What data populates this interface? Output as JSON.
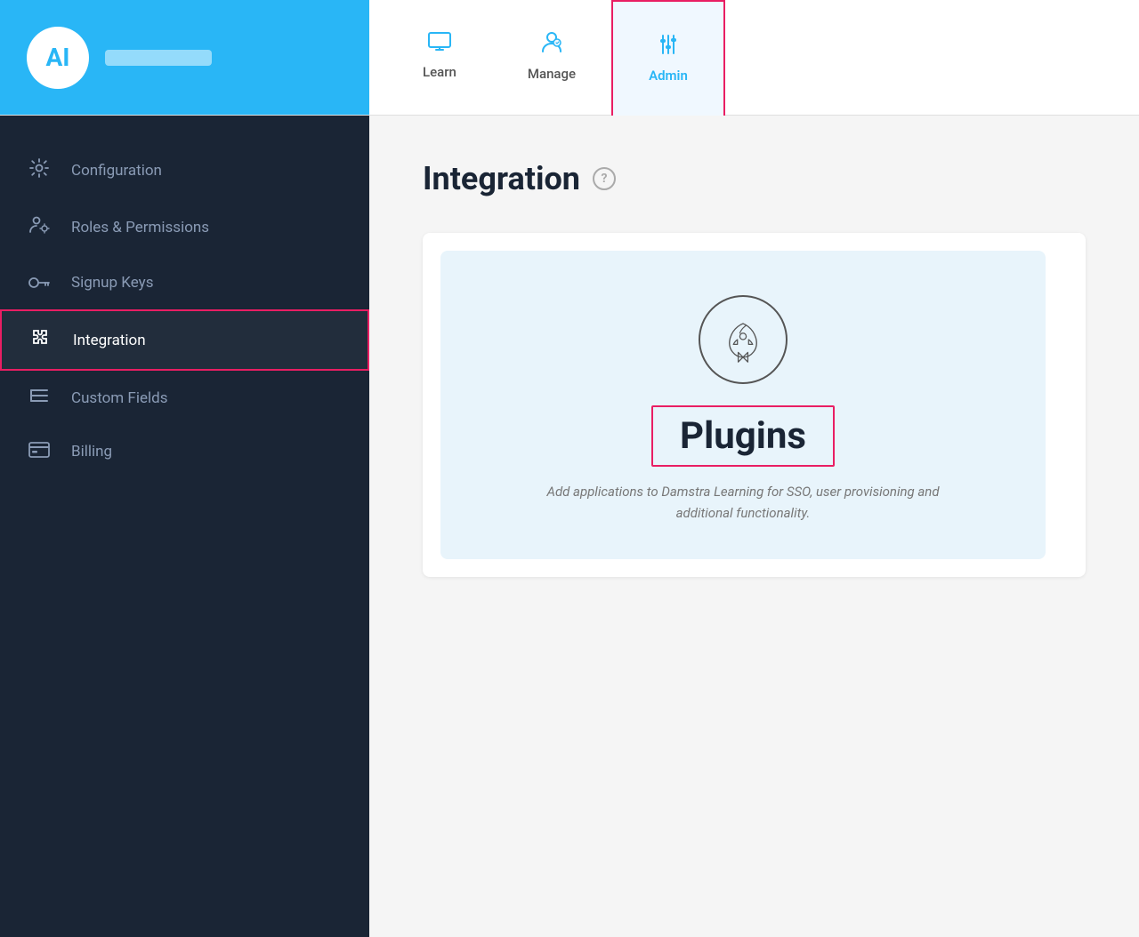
{
  "brand": {
    "initials": "AI",
    "name_blurred": true
  },
  "header": {
    "tabs": [
      {
        "id": "learn",
        "label": "Learn",
        "icon": "monitor",
        "active": false
      },
      {
        "id": "manage",
        "label": "Manage",
        "icon": "person",
        "active": false
      },
      {
        "id": "admin",
        "label": "Admin",
        "icon": "sliders",
        "active": true
      }
    ]
  },
  "sidebar": {
    "items": [
      {
        "id": "configuration",
        "label": "Configuration",
        "icon": "gear",
        "active": false
      },
      {
        "id": "roles-permissions",
        "label": "Roles & Permissions",
        "icon": "person-gear",
        "active": false
      },
      {
        "id": "signup-keys",
        "label": "Signup Keys",
        "icon": "key",
        "active": false
      },
      {
        "id": "integration",
        "label": "Integration",
        "icon": "puzzle",
        "active": true
      },
      {
        "id": "custom-fields",
        "label": "Custom Fields",
        "icon": "list",
        "active": false
      },
      {
        "id": "billing",
        "label": "Billing",
        "icon": "card",
        "active": false
      }
    ]
  },
  "page": {
    "title": "Integration",
    "help_tooltip": "?"
  },
  "plugin_card": {
    "title": "Plugins",
    "description": "Add applications to Damstra Learning for SSO, user provisioning and additional functionality."
  },
  "colors": {
    "accent_blue": "#29b6f6",
    "highlight_red": "#e91e63",
    "sidebar_bg": "#1a2535",
    "content_bg": "#f5f5f5"
  }
}
